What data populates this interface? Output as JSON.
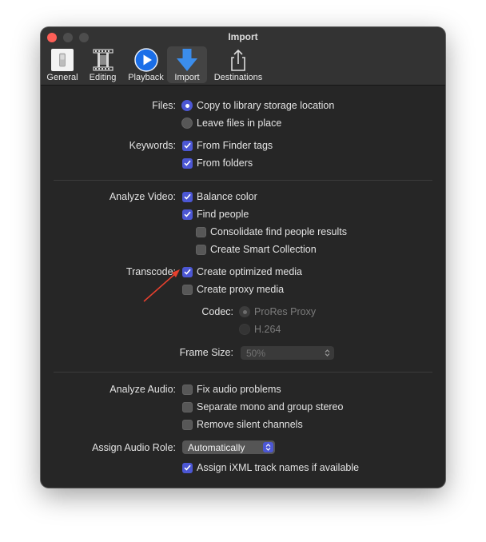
{
  "window": {
    "title": "Import"
  },
  "toolbar": {
    "tabs": [
      {
        "label": "General",
        "icon": "general-switch-icon"
      },
      {
        "label": "Editing",
        "icon": "film-strip-icon"
      },
      {
        "label": "Playback",
        "icon": "play-icon"
      },
      {
        "label": "Import",
        "icon": "download-arrow-icon",
        "selected": true
      },
      {
        "label": "Destinations",
        "icon": "share-icon"
      }
    ]
  },
  "files": {
    "label": "Files:",
    "options": [
      {
        "label": "Copy to library storage location",
        "selected": true
      },
      {
        "label": "Leave files in place",
        "selected": false
      }
    ]
  },
  "keywords": {
    "label": "Keywords:",
    "options": [
      {
        "label": "From Finder tags",
        "checked": true
      },
      {
        "label": "From folders",
        "checked": true
      }
    ]
  },
  "analyze_video": {
    "label": "Analyze Video:",
    "options": [
      {
        "label": "Balance color",
        "checked": true
      },
      {
        "label": "Find people",
        "checked": true
      },
      {
        "label": "Consolidate find people results",
        "checked": false
      },
      {
        "label": "Create Smart Collection",
        "checked": false
      }
    ]
  },
  "transcode": {
    "label": "Transcode:",
    "options": [
      {
        "label": "Create optimized media",
        "checked": true
      },
      {
        "label": "Create proxy media",
        "checked": false
      }
    ],
    "codec": {
      "label": "Codec:",
      "options": [
        {
          "label": "ProRes Proxy",
          "selected": true
        },
        {
          "label": "H.264",
          "selected": false
        }
      ]
    },
    "frame_size": {
      "label": "Frame Size:",
      "value": "50%"
    }
  },
  "analyze_audio": {
    "label": "Analyze Audio:",
    "options": [
      {
        "label": "Fix audio problems",
        "checked": false
      },
      {
        "label": "Separate mono and group stereo",
        "checked": false
      },
      {
        "label": "Remove silent channels",
        "checked": false
      }
    ]
  },
  "assign_audio_role": {
    "label": "Assign Audio Role:",
    "value": "Automatically",
    "ixml_option": {
      "label": "Assign iXML track names if available",
      "checked": true
    }
  },
  "colors": {
    "window_bg": "#262626",
    "titlebar_bg": "#333333",
    "accent": "#4c57d4",
    "close_button": "#fe5f57",
    "annotation_arrow": "#e8402e"
  }
}
